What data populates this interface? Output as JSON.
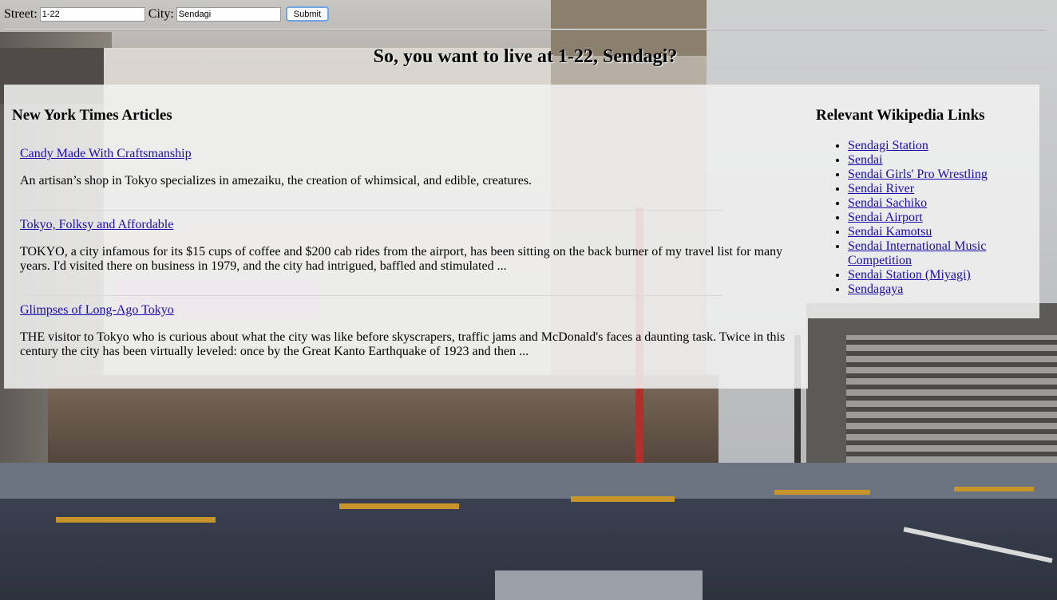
{
  "form": {
    "street_label": "Street:",
    "street_value": "1-22",
    "city_label": "City:",
    "city_value": "Sendagi",
    "submit_label": "Submit"
  },
  "page_title": "So, you want to live at 1-22, Sendagi?",
  "nyt": {
    "heading": "New York Times Articles",
    "articles": [
      {
        "title": "Candy Made With Craftsmanship",
        "snippet": "An artisan’s shop in Tokyo specializes in amezaiku, the creation of whimsical, and edible, creatures."
      },
      {
        "title": "Tokyo, Folksy and Affordable",
        "snippet": "TOKYO, a city infamous for its $15 cups of coffee and $200 cab rides from the airport, has been sitting on the back burner of my travel list for many years. I'd visited there on business in 1979, and the city had intrigued, baffled and stimulated ..."
      },
      {
        "title": "Glimpses of Long-Ago Tokyo",
        "snippet": "THE visitor to Tokyo who is curious about what the city was like before skyscrapers, traffic jams and McDonald's faces a daunting task. Twice in this century the city has been virtually leveled: once by the Great Kanto Earthquake of 1923 and then ..."
      }
    ]
  },
  "wiki": {
    "heading": "Relevant Wikipedia Links",
    "links": [
      "Sendagi Station",
      "Sendai",
      "Sendai Girls' Pro Wrestling",
      "Sendai River",
      "Sendai Sachiko",
      "Sendai Airport",
      "Sendai Kamotsu",
      "Sendai International Music Competition",
      "Sendai Station (Miyagi)",
      "Sendagaya"
    ]
  }
}
